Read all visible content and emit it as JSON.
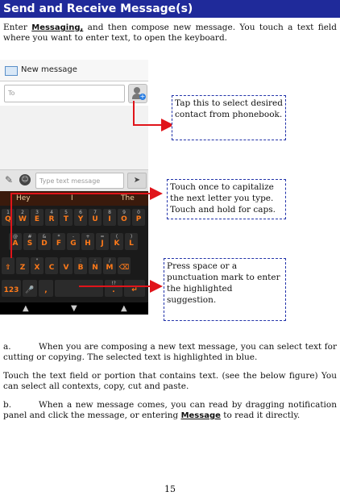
{
  "title": "Send and Receive Message(s)",
  "intro": {
    "before": "Enter ",
    "keyword": "Messaging,",
    "after": " and then compose new message. You touch a text field where you want to enter text, to open the keyboard."
  },
  "phone": {
    "header_title": "New message",
    "to_placeholder": "To",
    "compose_placeholder": "Type text message",
    "suggestions": [
      "Hey",
      "I",
      "The"
    ],
    "rows": [
      [
        {
          "k": "Q",
          "s": "1"
        },
        {
          "k": "W",
          "s": "2"
        },
        {
          "k": "E",
          "s": "3"
        },
        {
          "k": "R",
          "s": "4"
        },
        {
          "k": "T",
          "s": "5"
        },
        {
          "k": "Y",
          "s": "6"
        },
        {
          "k": "U",
          "s": "7"
        },
        {
          "k": "I",
          "s": "8"
        },
        {
          "k": "O",
          "s": "9"
        },
        {
          "k": "P",
          "s": "0"
        }
      ],
      [
        {
          "k": "A",
          "s": "@"
        },
        {
          "k": "S",
          "s": "#"
        },
        {
          "k": "D",
          "s": "&"
        },
        {
          "k": "F",
          "s": "*"
        },
        {
          "k": "G",
          "s": "-"
        },
        {
          "k": "H",
          "s": "+"
        },
        {
          "k": "J",
          "s": "="
        },
        {
          "k": "K",
          "s": "("
        },
        {
          "k": "L",
          "s": ")"
        }
      ],
      [
        {
          "k": "⇧",
          "s": ""
        },
        {
          "k": "Z",
          "s": ""
        },
        {
          "k": "X",
          "s": "\""
        },
        {
          "k": "C",
          "s": ""
        },
        {
          "k": "V",
          "s": ""
        },
        {
          "k": "B",
          "s": ":"
        },
        {
          "k": "N",
          "s": ";"
        },
        {
          "k": "M",
          "s": "/"
        },
        {
          "k": "⌫",
          "s": ""
        }
      ],
      [
        {
          "k": "123",
          "s": ""
        },
        {
          "k": "🎤",
          "s": ""
        },
        {
          "k": ",",
          "s": ""
        },
        {
          "k": "",
          "s": ""
        },
        {
          "k": ".",
          "s": "!?"
        },
        {
          "k": "↵",
          "s": ""
        }
      ]
    ]
  },
  "callouts": {
    "contact": "Tap this to select desired contact from phonebook.",
    "capitalize": "Touch once to capitalize the next letter you type. Touch and hold for caps.",
    "space": "Press space or a punctuation mark to enter the highlighted suggestion."
  },
  "para_a": {
    "label": "a.",
    "text": "When you are composing a new text message, you can select text for cutting or copying. The selected text is highlighted in blue."
  },
  "para_touch": "Touch the text field or portion that contains text.  (see the below figure) You can select all contexts, copy, cut and paste.",
  "para_b": {
    "label": "b.",
    "text_before": "When a new message comes, you can read by dragging notification panel and click the message, or entering ",
    "keyword": "Message",
    "text_after": " to read it directly."
  },
  "page_number": "15",
  "colors": {
    "title_bg": "#1f2a9a",
    "arrow": "#e0141a",
    "callout_border": "#2233aa",
    "key_text": "#ff7a1a"
  }
}
